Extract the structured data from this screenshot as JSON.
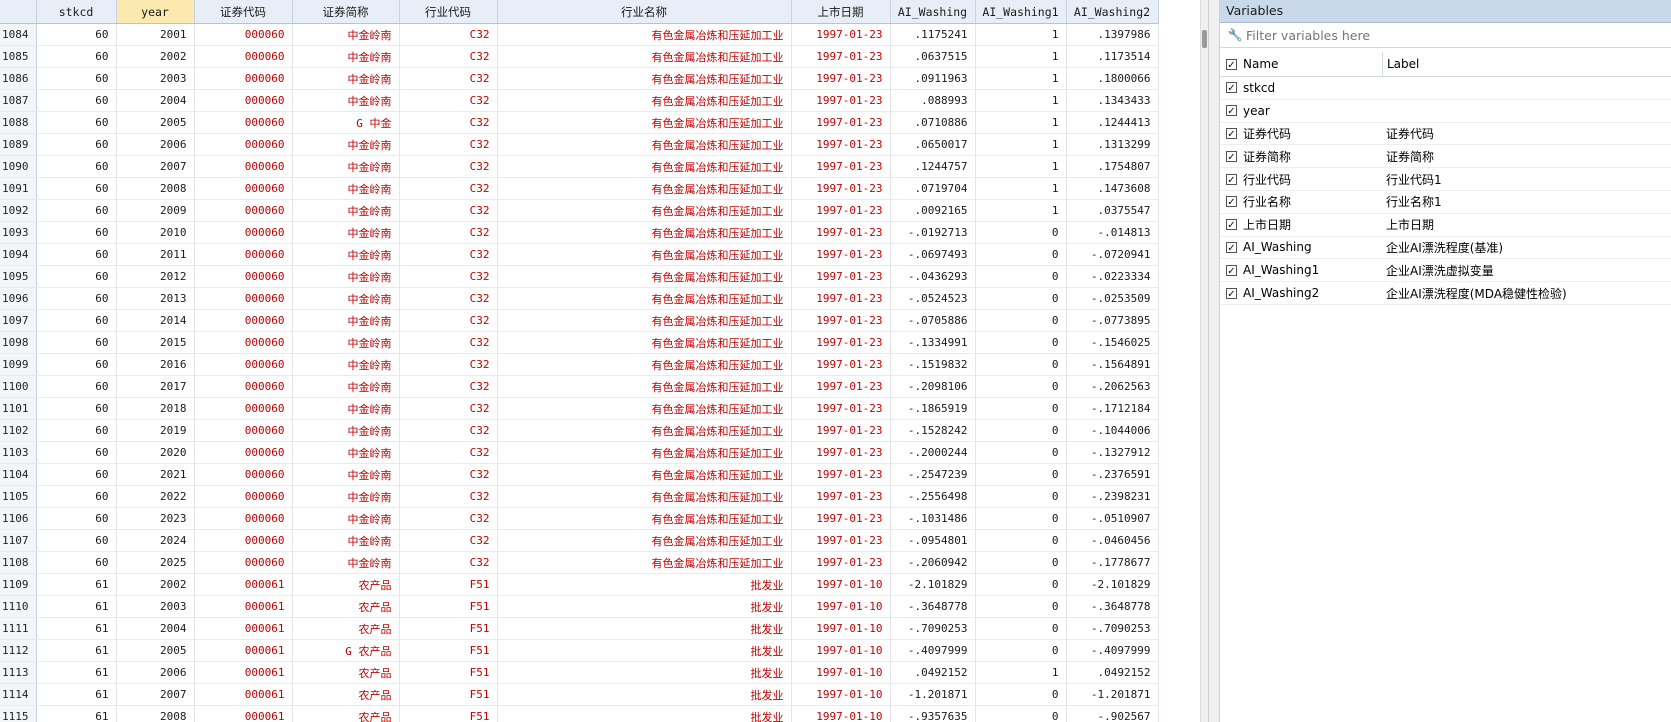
{
  "columns": [
    {
      "key": "stkcd",
      "label": "stkcd",
      "w": 80
    },
    {
      "key": "year",
      "label": "year",
      "w": 78,
      "sel": true
    },
    {
      "key": "code",
      "label": "证券代码",
      "w": 98,
      "str": true
    },
    {
      "key": "abbr",
      "label": "证券简称",
      "w": 107,
      "str": true
    },
    {
      "key": "ind_code",
      "label": "行业代码",
      "w": 98,
      "str": true
    },
    {
      "key": "ind_name",
      "label": "行业名称",
      "w": 294,
      "str": true
    },
    {
      "key": "list_date",
      "label": "上市日期",
      "w": 99,
      "str": true
    },
    {
      "key": "aiw",
      "label": "AI_Washing",
      "w": 85
    },
    {
      "key": "aiw1",
      "label": "AI_Washing1",
      "w": 91
    },
    {
      "key": "aiw2",
      "label": "AI_Washing2",
      "w": 92
    }
  ],
  "rows": [
    [
      "1084",
      "60",
      "2001",
      "000060",
      "中金岭南",
      "C32",
      "有色金属冶炼和压延加工业",
      "1997-01-23",
      ".1175241",
      "1",
      ".1397986"
    ],
    [
      "1085",
      "60",
      "2002",
      "000060",
      "中金岭南",
      "C32",
      "有色金属冶炼和压延加工业",
      "1997-01-23",
      ".0637515",
      "1",
      ".1173514"
    ],
    [
      "1086",
      "60",
      "2003",
      "000060",
      "中金岭南",
      "C32",
      "有色金属冶炼和压延加工业",
      "1997-01-23",
      ".0911963",
      "1",
      ".1800066"
    ],
    [
      "1087",
      "60",
      "2004",
      "000060",
      "中金岭南",
      "C32",
      "有色金属冶炼和压延加工业",
      "1997-01-23",
      ".088993",
      "1",
      ".1343433"
    ],
    [
      "1088",
      "60",
      "2005",
      "000060",
      "G 中金",
      "C32",
      "有色金属冶炼和压延加工业",
      "1997-01-23",
      ".0710886",
      "1",
      ".1244413"
    ],
    [
      "1089",
      "60",
      "2006",
      "000060",
      "中金岭南",
      "C32",
      "有色金属冶炼和压延加工业",
      "1997-01-23",
      ".0650017",
      "1",
      ".1313299"
    ],
    [
      "1090",
      "60",
      "2007",
      "000060",
      "中金岭南",
      "C32",
      "有色金属冶炼和压延加工业",
      "1997-01-23",
      ".1244757",
      "1",
      ".1754807"
    ],
    [
      "1091",
      "60",
      "2008",
      "000060",
      "中金岭南",
      "C32",
      "有色金属冶炼和压延加工业",
      "1997-01-23",
      ".0719704",
      "1",
      ".1473608"
    ],
    [
      "1092",
      "60",
      "2009",
      "000060",
      "中金岭南",
      "C32",
      "有色金属冶炼和压延加工业",
      "1997-01-23",
      ".0092165",
      "1",
      ".0375547"
    ],
    [
      "1093",
      "60",
      "2010",
      "000060",
      "中金岭南",
      "C32",
      "有色金属冶炼和压延加工业",
      "1997-01-23",
      "-.0192713",
      "0",
      "-.014813"
    ],
    [
      "1094",
      "60",
      "2011",
      "000060",
      "中金岭南",
      "C32",
      "有色金属冶炼和压延加工业",
      "1997-01-23",
      "-.0697493",
      "0",
      "-.0720941"
    ],
    [
      "1095",
      "60",
      "2012",
      "000060",
      "中金岭南",
      "C32",
      "有色金属冶炼和压延加工业",
      "1997-01-23",
      "-.0436293",
      "0",
      "-.0223334"
    ],
    [
      "1096",
      "60",
      "2013",
      "000060",
      "中金岭南",
      "C32",
      "有色金属冶炼和压延加工业",
      "1997-01-23",
      "-.0524523",
      "0",
      "-.0253509"
    ],
    [
      "1097",
      "60",
      "2014",
      "000060",
      "中金岭南",
      "C32",
      "有色金属冶炼和压延加工业",
      "1997-01-23",
      "-.0705886",
      "0",
      "-.0773895"
    ],
    [
      "1098",
      "60",
      "2015",
      "000060",
      "中金岭南",
      "C32",
      "有色金属冶炼和压延加工业",
      "1997-01-23",
      "-.1334991",
      "0",
      "-.1546025"
    ],
    [
      "1099",
      "60",
      "2016",
      "000060",
      "中金岭南",
      "C32",
      "有色金属冶炼和压延加工业",
      "1997-01-23",
      "-.1519832",
      "0",
      "-.1564891"
    ],
    [
      "1100",
      "60",
      "2017",
      "000060",
      "中金岭南",
      "C32",
      "有色金属冶炼和压延加工业",
      "1997-01-23",
      "-.2098106",
      "0",
      "-.2062563"
    ],
    [
      "1101",
      "60",
      "2018",
      "000060",
      "中金岭南",
      "C32",
      "有色金属冶炼和压延加工业",
      "1997-01-23",
      "-.1865919",
      "0",
      "-.1712184"
    ],
    [
      "1102",
      "60",
      "2019",
      "000060",
      "中金岭南",
      "C32",
      "有色金属冶炼和压延加工业",
      "1997-01-23",
      "-.1528242",
      "0",
      "-.1044006"
    ],
    [
      "1103",
      "60",
      "2020",
      "000060",
      "中金岭南",
      "C32",
      "有色金属冶炼和压延加工业",
      "1997-01-23",
      "-.2000244",
      "0",
      "-.1327912"
    ],
    [
      "1104",
      "60",
      "2021",
      "000060",
      "中金岭南",
      "C32",
      "有色金属冶炼和压延加工业",
      "1997-01-23",
      "-.2547239",
      "0",
      "-.2376591"
    ],
    [
      "1105",
      "60",
      "2022",
      "000060",
      "中金岭南",
      "C32",
      "有色金属冶炼和压延加工业",
      "1997-01-23",
      "-.2556498",
      "0",
      "-.2398231"
    ],
    [
      "1106",
      "60",
      "2023",
      "000060",
      "中金岭南",
      "C32",
      "有色金属冶炼和压延加工业",
      "1997-01-23",
      "-.1031486",
      "0",
      "-.0510907"
    ],
    [
      "1107",
      "60",
      "2024",
      "000060",
      "中金岭南",
      "C32",
      "有色金属冶炼和压延加工业",
      "1997-01-23",
      "-.0954801",
      "0",
      "-.0460456"
    ],
    [
      "1108",
      "60",
      "2025",
      "000060",
      "中金岭南",
      "C32",
      "有色金属冶炼和压延加工业",
      "1997-01-23",
      "-.2060942",
      "0",
      "-.1778677"
    ],
    [
      "1109",
      "61",
      "2002",
      "000061",
      "农产品",
      "F51",
      "批发业",
      "1997-01-10",
      "-2.101829",
      "0",
      "-2.101829"
    ],
    [
      "1110",
      "61",
      "2003",
      "000061",
      "农产品",
      "F51",
      "批发业",
      "1997-01-10",
      "-.3648778",
      "0",
      "-.3648778"
    ],
    [
      "1111",
      "61",
      "2004",
      "000061",
      "农产品",
      "F51",
      "批发业",
      "1997-01-10",
      "-.7090253",
      "0",
      "-.7090253"
    ],
    [
      "1112",
      "61",
      "2005",
      "000061",
      "G 农产品",
      "F51",
      "批发业",
      "1997-01-10",
      "-.4097999",
      "0",
      "-.4097999"
    ],
    [
      "1113",
      "61",
      "2006",
      "000061",
      "农产品",
      "F51",
      "批发业",
      "1997-01-10",
      ".0492152",
      "1",
      ".0492152"
    ],
    [
      "1114",
      "61",
      "2007",
      "000061",
      "农产品",
      "F51",
      "批发业",
      "1997-01-10",
      "-1.201871",
      "0",
      "-1.201871"
    ],
    [
      "1115",
      "61",
      "2008",
      "000061",
      "农产品",
      "F51",
      "批发业",
      "1997-01-10",
      "-.9357635",
      "0",
      "-.902567"
    ]
  ],
  "variables_panel": {
    "title": "Variables",
    "filter_placeholder": "Filter variables here",
    "header_name": "Name",
    "header_label": "Label",
    "items": [
      {
        "name": "stkcd",
        "label": ""
      },
      {
        "name": "year",
        "label": ""
      },
      {
        "name": "证券代码",
        "label": "证券代码"
      },
      {
        "name": "证券简称",
        "label": "证券简称"
      },
      {
        "name": "行业代码",
        "label": "行业代码1"
      },
      {
        "name": "行业名称",
        "label": "行业名称1"
      },
      {
        "name": "上市日期",
        "label": "上市日期"
      },
      {
        "name": "AI_Washing",
        "label": "企业AI漂洗程度(基准)"
      },
      {
        "name": "AI_Washing1",
        "label": "企业AI漂洗虚拟变量"
      },
      {
        "name": "AI_Washing2",
        "label": "企业AI漂洗程度(MDA稳健性检验)"
      }
    ]
  },
  "colors": {
    "string_text": "#c00000",
    "selected_header": "#fbe9b0",
    "panel_title": "#c9d9eb"
  }
}
